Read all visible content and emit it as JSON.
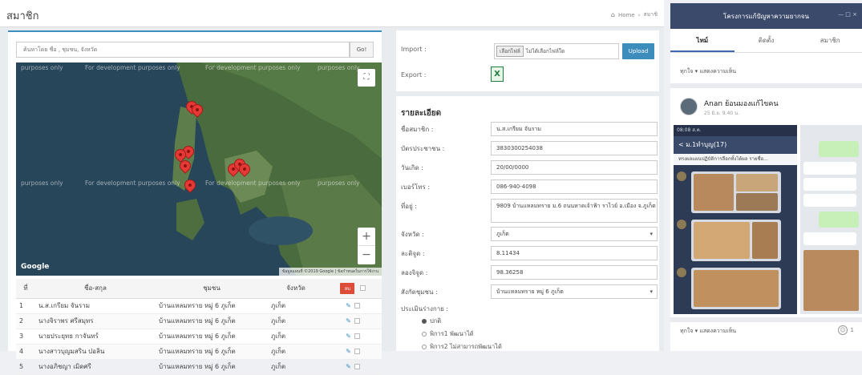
{
  "header": {
    "title": "สมาชิก",
    "breadcrumb_home": "Home",
    "breadcrumb_current": "สมาชิ"
  },
  "search": {
    "placeholder": "ค้นหาโดย ชื่อ , ชุมชน, จังหวัด",
    "go_label": "Go!"
  },
  "map": {
    "dev_text": "For development purposes only",
    "dev_text_short": "purposes only",
    "logo": "Google",
    "attribution": "ข้อมูลแผนที่ ©2019 Google | ข้อกำหนดในการใช้งาน",
    "fullscreen_icon": "fullscreen-icon",
    "zoom_in": "+",
    "zoom_out": "−"
  },
  "table": {
    "headers": [
      "ที่",
      "ชื่อ-สกุล",
      "ชุมชน",
      "จังหวัด"
    ],
    "delete_label": "ลบ",
    "rows": [
      {
        "no": "1",
        "name": "น.ส.เกรียม จันราม",
        "community": "บ้านแหลมทราย หมู่ 6 ภูเก็ต",
        "province": "ภูเก็ต"
      },
      {
        "no": "2",
        "name": "นางจิราพร ศรีสมุทร",
        "community": "บ้านแหลมทราย หมู่ 6 ภูเก็ต",
        "province": "ภูเก็ต"
      },
      {
        "no": "3",
        "name": "นายประยุทธ กาจันทร์",
        "community": "บ้านแหลมทราย หมู่ 6 ภูเก็ต",
        "province": "ภูเก็ต"
      },
      {
        "no": "4",
        "name": "นางสาวบุญมสริน ปอลิน",
        "community": "บ้านแหลมทราย หมู่ 6 ภูเก็ต",
        "province": "ภูเก็ต"
      },
      {
        "no": "5",
        "name": "นางอภิชญา เมิดศรี",
        "community": "บ้านแหลมทราย หมู่ 6 ภูเก็ต",
        "province": "ภูเก็ต"
      }
    ]
  },
  "io": {
    "import_label": "Import :",
    "export_label": "Export :",
    "file_button": "เลือกไฟล์",
    "file_none": "ไม่ได้เลือกไฟล์ใด",
    "upload_label": "Upload"
  },
  "detail": {
    "title": "รายละเอียด",
    "fields": [
      {
        "label": "ชื่อสมาชิก :",
        "value": "น.ส.เกรียม จันราม"
      },
      {
        "label": "บัตรประชาชน :",
        "value": "3830300254038"
      },
      {
        "label": "วันเกิด :",
        "value": "20/00/0000"
      },
      {
        "label": "เบอร์โทร :",
        "value": "086-940-4098"
      },
      {
        "label": "ที่อยู่ :",
        "value": "9809 บ้านแหลมทราย ม.6 ถนนหาดเจ้าฟ้า ราไวย์ อ.เมือง จ.ภูเก็ต"
      },
      {
        "label": "จังหวัด :",
        "value": "ภูเก็ต"
      },
      {
        "label": "ละติจูด :",
        "value": "8.11434"
      },
      {
        "label": "ลองจิจูด :",
        "value": "98.36258"
      },
      {
        "label": "สังกัดชุมชน :",
        "value": "บ้านแหลมทราย หมู่ 6 ภูเก็ต"
      }
    ],
    "assessment_label": "ประเมินร่างกาย :",
    "options": [
      "ปกติ",
      "พิการ1 พัฒนาได้",
      "พิการ2 ไม่สามารถพัฒนาได้"
    ]
  },
  "social": {
    "title": "โครงการแก้ปัญหาความยากจน",
    "window_controls": "— □ ×",
    "tabs": [
      "ไทม์",
      "ติดตั้ง",
      "สมาชิก"
    ],
    "filter_top": "ทุกใจ ▾  แสดงความเห็น",
    "author": "Anan ย้อนมองแก้ไขคน",
    "post_date": "25 มิ.ย. 9.40 น.",
    "phone_status": "08:08 ส.ค.",
    "chat_title": "< ม.1ทำบุญ(17)",
    "chat_notice": "ทรงผลแผนปฏิบัติการลือกทั้งได้ผล รายชื่อ...",
    "filter_bottom": "ทุกใจ ▾  แสดงความเห็น",
    "reaction_count": "1"
  },
  "colors": {
    "accent": "#3c8dbc",
    "danger": "#dd4b39",
    "fb_header": "#3b4a6b",
    "pin": "#e53935"
  }
}
